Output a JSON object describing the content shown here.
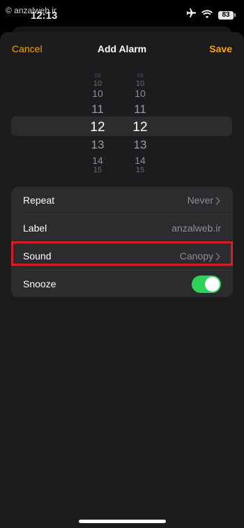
{
  "status": {
    "watermark": "© anzalweb.ir",
    "time": "12:13",
    "battery": "83"
  },
  "nav": {
    "cancel": "Cancel",
    "title": "Add Alarm",
    "save": "Save"
  },
  "picker": {
    "hours": [
      "09",
      "10",
      "10",
      "11",
      "12",
      "13",
      "14",
      "15"
    ],
    "minutes": [
      "09",
      "10",
      "10",
      "11",
      "12",
      "13",
      "14",
      "15"
    ],
    "selected_hour": "12",
    "selected_minute": "12"
  },
  "settings": {
    "repeat": {
      "label": "Repeat",
      "value": "Never"
    },
    "label": {
      "label": "Label",
      "value": "anzalweb.ir"
    },
    "sound": {
      "label": "Sound",
      "value": "Canopy"
    },
    "snooze": {
      "label": "Snooze",
      "on": true
    }
  },
  "colors": {
    "accent": "#ff9f0a",
    "toggle_on": "#30d158",
    "highlight": "#d81e2a"
  }
}
